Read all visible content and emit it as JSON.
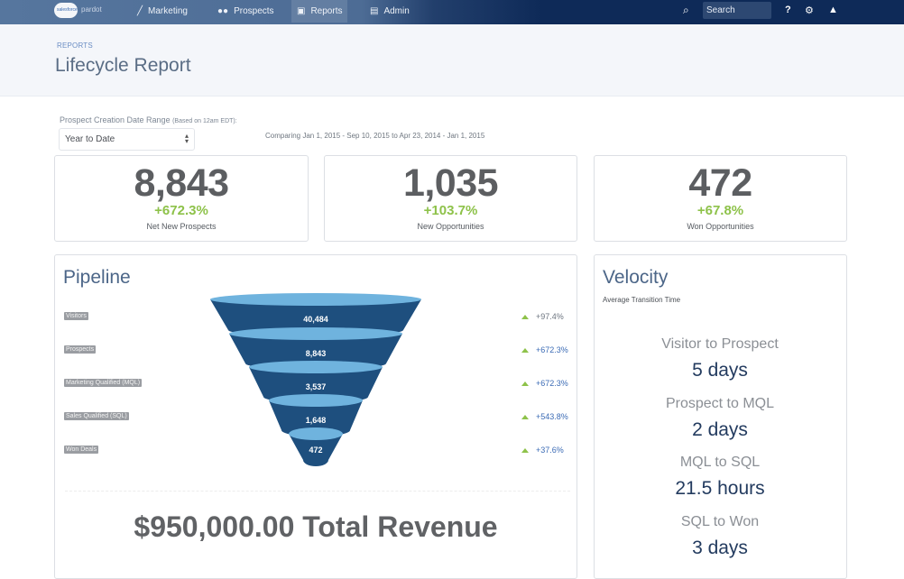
{
  "nav": {
    "logo_mark": "salesforce",
    "logo_text": "pardot",
    "items": [
      {
        "label": "Marketing",
        "icon": "wand-icon"
      },
      {
        "label": "Prospects",
        "icon": "people-icon"
      },
      {
        "label": "Reports",
        "icon": "report-icon",
        "active": true
      },
      {
        "label": "Admin",
        "icon": "briefcase-icon"
      }
    ],
    "search_placeholder": "Search",
    "help_label": "?"
  },
  "header": {
    "breadcrumb": "REPORTS",
    "title": "Lifecycle Report"
  },
  "filter": {
    "label": "Prospect Creation Date Range",
    "label_note": "(Based on 12am EDT):",
    "selected": "Year to Date",
    "comparing": "Comparing Jan 1, 2015 - Sep 10, 2015 to Apr 23, 2014 - Jan 1, 2015"
  },
  "stats": [
    {
      "value": "8,843",
      "change": "+672.3%",
      "label": "Net New Prospects"
    },
    {
      "value": "1,035",
      "change": "+103.7%",
      "label": "New Opportunities"
    },
    {
      "value": "472",
      "change": "+67.8%",
      "label": "Won Opportunities"
    }
  ],
  "pipeline": {
    "title": "Pipeline",
    "stages": [
      {
        "label": "Visitors",
        "value": "40,484",
        "change": "+97.4%",
        "change_color": "#6d7580"
      },
      {
        "label": "Prospects",
        "value": "8,843",
        "change": "+672.3%",
        "change_color": "#3b6bb5"
      },
      {
        "label": "Marketing Qualified (MQL)",
        "value": "3,537",
        "change": "+672.3%",
        "change_color": "#3b6bb5"
      },
      {
        "label": "Sales Qualified (SQL)",
        "value": "1,648",
        "change": "+543.8%",
        "change_color": "#3b6bb5"
      },
      {
        "label": "Won Deals",
        "value": "472",
        "change": "+37.6%",
        "change_color": "#3b6bb5"
      }
    ],
    "total_revenue": "$950,000.00 Total Revenue"
  },
  "velocity": {
    "title": "Velocity",
    "subtitle": "Average Transition Time",
    "transitions": [
      {
        "label": "Visitor to Prospect",
        "value": "5 days"
      },
      {
        "label": "Prospect to MQL",
        "value": "2 days"
      },
      {
        "label": "MQL to SQL",
        "value": "21.5 hours"
      },
      {
        "label": "SQL to Won",
        "value": "3 days"
      }
    ]
  },
  "colors": {
    "funnel_dark": "#1e4f7e",
    "funnel_light": "#6fb3de",
    "positive": "#8ec24a",
    "nav_dark": "#0e2a58"
  }
}
